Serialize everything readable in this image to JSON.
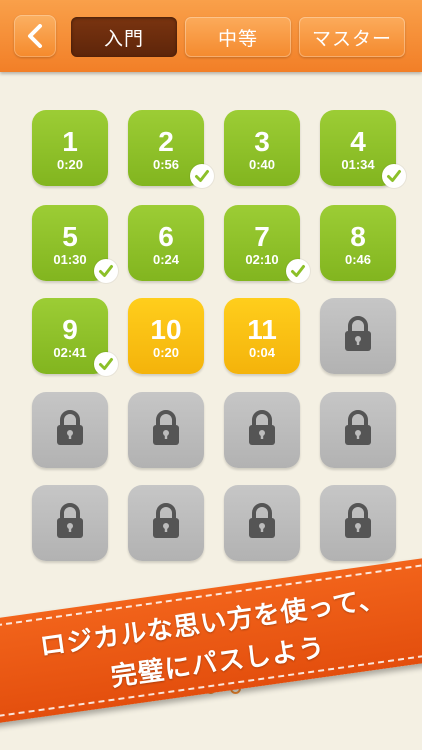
{
  "header": {
    "back_icon": "chevron-left-icon",
    "tabs": [
      {
        "label": "入門",
        "active": true
      },
      {
        "label": "中等",
        "active": false
      },
      {
        "label": "マスター",
        "active": false
      }
    ]
  },
  "levels": [
    {
      "num": "1",
      "time": "0:20",
      "state": "completed",
      "checked": false
    },
    {
      "num": "2",
      "time": "0:56",
      "state": "completed",
      "checked": true
    },
    {
      "num": "3",
      "time": "0:40",
      "state": "completed",
      "checked": false
    },
    {
      "num": "4",
      "time": "01:34",
      "state": "completed",
      "checked": true
    },
    {
      "num": "5",
      "time": "01:30",
      "state": "completed",
      "checked": true
    },
    {
      "num": "6",
      "time": "0:24",
      "state": "completed",
      "checked": false
    },
    {
      "num": "7",
      "time": "02:10",
      "state": "completed",
      "checked": true
    },
    {
      "num": "8",
      "time": "0:46",
      "state": "completed",
      "checked": false
    },
    {
      "num": "9",
      "time": "02:41",
      "state": "completed",
      "checked": true
    },
    {
      "num": "10",
      "time": "0:20",
      "state": "in-progress",
      "checked": false
    },
    {
      "num": "11",
      "time": "0:04",
      "state": "in-progress",
      "checked": false
    },
    {
      "state": "locked"
    },
    {
      "state": "locked"
    },
    {
      "state": "locked"
    },
    {
      "state": "locked"
    },
    {
      "state": "locked"
    },
    {
      "state": "locked"
    },
    {
      "state": "locked"
    },
    {
      "state": "locked"
    },
    {
      "state": "locked"
    }
  ],
  "banner": {
    "line1": "ロジカルな思い方を使って、",
    "line2": "完璧にパスしよう"
  },
  "colors": {
    "header_orange": "#f27f27",
    "tile_green": "#8cc029",
    "tile_yellow": "#fbc214",
    "tile_locked": "#bcbcbc",
    "banner_orange": "#e85512",
    "background": "#f4f0e3"
  }
}
